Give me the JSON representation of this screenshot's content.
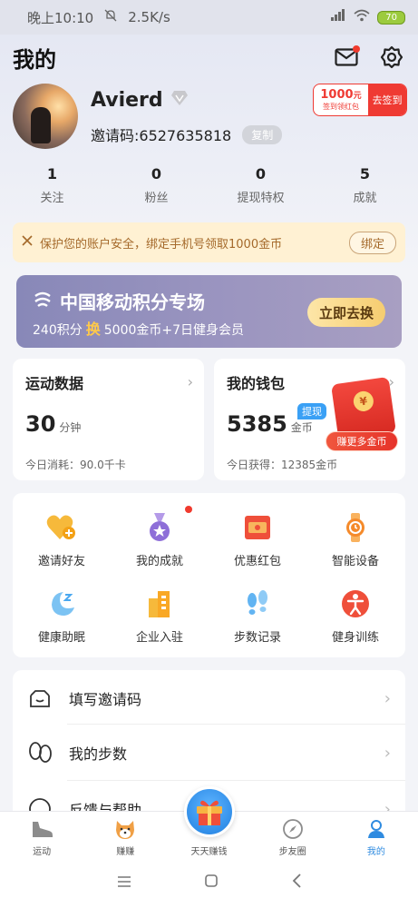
{
  "status_bar": {
    "time": "晚上10:10",
    "speed": "2.5K/s",
    "battery": "70"
  },
  "header": {
    "title": "我的"
  },
  "profile": {
    "username": "Avierd",
    "invite_code": "邀请码:6527635818",
    "copy_label": "复制",
    "checkin": {
      "amount": "1000",
      "unit": "元",
      "sub": "签到领红包",
      "action": "去签到"
    }
  },
  "stats": [
    {
      "value": "1",
      "label": "关注"
    },
    {
      "value": "0",
      "label": "粉丝"
    },
    {
      "value": "0",
      "label": "提现特权"
    },
    {
      "value": "5",
      "label": "成就"
    }
  ],
  "notice": {
    "text": "保护您的账户安全，绑定手机号领取1000金币",
    "button": "绑定"
  },
  "mobile_banner": {
    "title": "中国移动积分专场",
    "sub_left": "240积分",
    "swap": "换",
    "sub_right": "5000金币+7日健身会员",
    "button": "立即去换"
  },
  "sport_card": {
    "title": "运动数据",
    "value": "30",
    "unit": "分钟",
    "footer": "今日消耗：90.0千卡"
  },
  "wallet_card": {
    "title": "我的钱包",
    "value": "5385",
    "unit": "金币",
    "withdraw": "提现",
    "footer": "今日获得：12385金币",
    "earn_more": "赚更多金币",
    "coin_glyph": "¥"
  },
  "grid": [
    {
      "label": "邀请好友",
      "icon": "heart-plus-icon",
      "color": "#f6b93b"
    },
    {
      "label": "我的成就",
      "icon": "medal-icon",
      "color": "#8e6fd8"
    },
    {
      "label": "优惠红包",
      "icon": "red-packet-icon",
      "color": "#ef4f3a"
    },
    {
      "label": "智能设备",
      "icon": "watch-icon",
      "color": "#f58a2a"
    },
    {
      "label": "健康助眠",
      "icon": "moon-icon",
      "color": "#5fb6ee"
    },
    {
      "label": "企业入驻",
      "icon": "building-icon",
      "color": "#f6b93b"
    },
    {
      "label": "步数记录",
      "icon": "footprints-icon",
      "color": "#4aa8f0"
    },
    {
      "label": "健身训练",
      "icon": "fitness-icon",
      "color": "#ef4f3a"
    }
  ],
  "list": [
    {
      "label": "填写邀请码",
      "icon": "invite-code-icon"
    },
    {
      "label": "我的步数",
      "icon": "steps-icon"
    },
    {
      "label": "反馈与帮助",
      "icon": "help-icon"
    }
  ],
  "tabbar": [
    {
      "label": "运动",
      "icon": "shoe-icon"
    },
    {
      "label": "赚赚",
      "icon": "shiba-icon"
    },
    {
      "label": "天天赚钱",
      "icon": "gift-icon"
    },
    {
      "label": "步友圈",
      "icon": "compass-icon"
    },
    {
      "label": "我的",
      "icon": "person-icon"
    }
  ],
  "colors": {
    "accent": "#2f8be0",
    "red": "#ef3a33",
    "notice_bg": "#fff1d3"
  }
}
